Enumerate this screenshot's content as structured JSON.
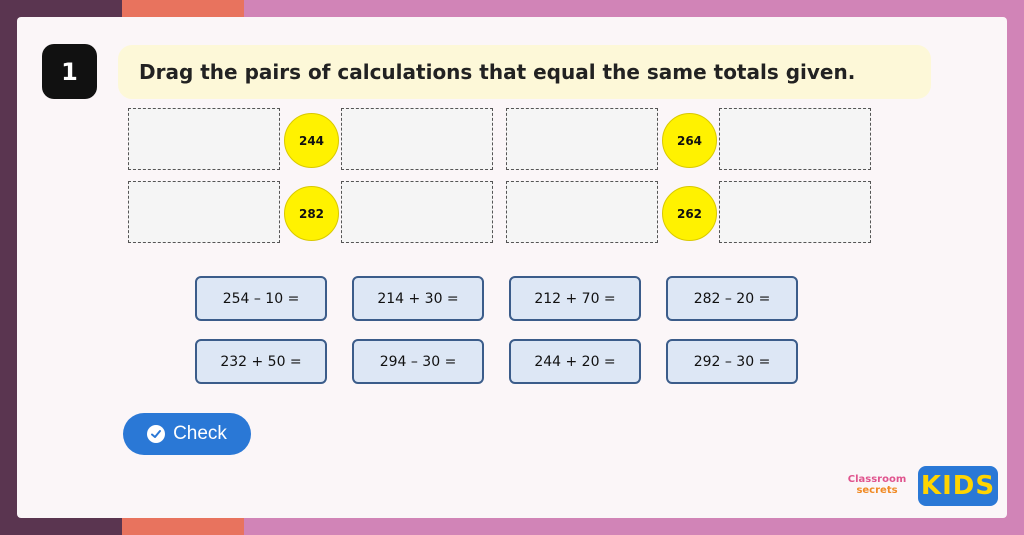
{
  "question": {
    "number": "1",
    "instruction": "Drag the pairs of calculations that equal the same totals given."
  },
  "targets": [
    "244",
    "264",
    "282",
    "262"
  ],
  "tiles": [
    "254 – 10 =",
    "214 + 30 =",
    "212 + 70 =",
    "282 – 20 =",
    "232 + 50 =",
    "294 – 30 =",
    "244 + 20 =",
    "292 – 30  ="
  ],
  "check_button": {
    "label": "Check",
    "icon": "check-circle-icon"
  },
  "logo": {
    "line1": "Classroom",
    "line2": "secrets",
    "kids": "KIDS"
  },
  "colors": {
    "target_fill": "#fff200",
    "tile_fill": "#dde7f5",
    "tile_border": "#3b5c8a",
    "button_fill": "#2a78d6",
    "banner_fill": "#fdf8d8"
  }
}
